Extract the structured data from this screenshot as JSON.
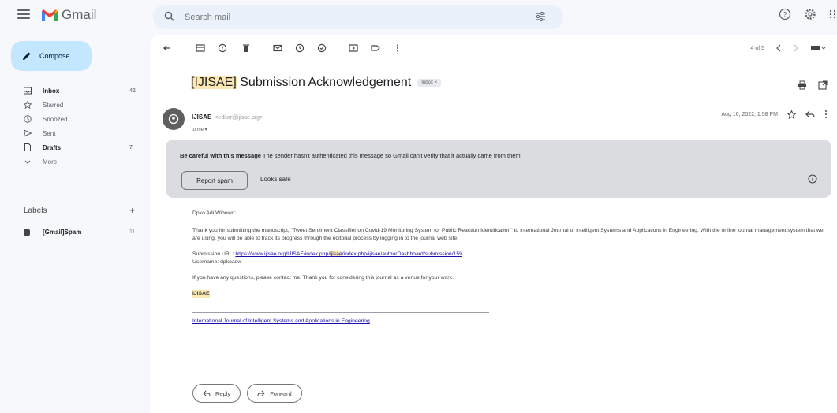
{
  "app": {
    "name": "Gmail"
  },
  "search": {
    "placeholder": "Search mail"
  },
  "sidebar": {
    "compose": "Compose",
    "items": [
      {
        "label": "Inbox",
        "count": "42",
        "icon": "inbox-icon",
        "bold": true
      },
      {
        "label": "Starred",
        "count": "",
        "icon": "star-icon",
        "bold": false
      },
      {
        "label": "Snoozed",
        "count": "",
        "icon": "clock-icon",
        "bold": false
      },
      {
        "label": "Sent",
        "count": "",
        "icon": "send-icon",
        "bold": false
      },
      {
        "label": "Drafts",
        "count": "7",
        "icon": "draft-icon",
        "bold": true
      },
      {
        "label": "More",
        "count": "",
        "icon": "chevron-down-icon",
        "bold": false
      }
    ],
    "labels_heading": "Labels",
    "labels_add": "+",
    "labels": [
      {
        "label": "[Gmail]Spam",
        "count": "11"
      }
    ]
  },
  "toolbar": {
    "page_info": "4 of 5"
  },
  "email": {
    "subject_highlight": "[IJISAE]",
    "subject_rest": " Submission Acknowledgement",
    "tag": "Inbox ×",
    "sender_name": "IJISAE",
    "sender_email": "<editor@ijisae.org>",
    "to": "to me ▾",
    "date": "Aug 16, 2022, 1:58 PM",
    "warning": {
      "title": "Be careful with this message",
      "text": " The sender hasn't authenticated this message so Gmail can't verify that it actually came from them.",
      "report_btn": "Report spam",
      "safe_btn": "Looks safe"
    },
    "body": {
      "greeting": "Dpko Adi Wibowo:",
      "para1": "Thank you for submitting the manuscript, \"Tweet Sentiment Classifier on Covid-19 Monitoring System for Public Reaction Identification\" to International Journal of Intelligent Systems and Applications in Engineering. With the online journal management system that we are using, you will be able to track its progress through the editorial process by logging in to the journal web site:",
      "url_label": "Submission URL: ",
      "url_pre": "https://www.ijisae.org/IJISAE/index.php/",
      "url_hl": "ijisae",
      "url_post": "/index.php/ijisae/authorDashboard/submission/159",
      "username": "Username: dpkoadw",
      "para2": "If you have any questions, please contact me. Thank you for considering this journal as a venue for your work.",
      "signature": "IJISAE",
      "footer_link": "International Journal of Intelligent Systems and Applications in Engineering"
    },
    "reply": "Reply",
    "forward": "Forward"
  },
  "colors": {
    "accent": "#c2e7ff",
    "highlight": "#fce8b2",
    "warning_bg": "#dadce0"
  }
}
